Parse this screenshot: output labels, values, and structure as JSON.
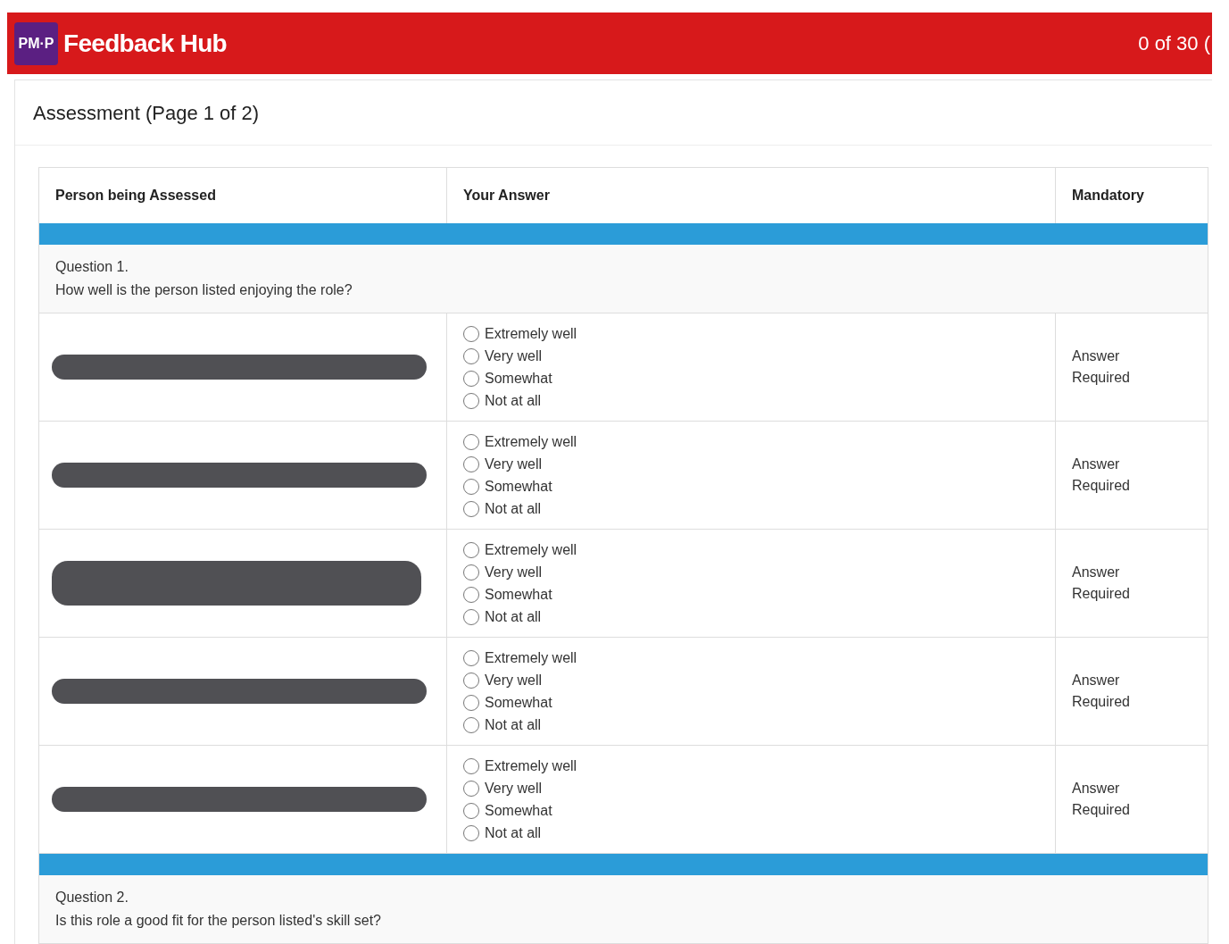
{
  "header": {
    "logo": "PM·P",
    "title": "Feedback Hub",
    "progress": "0 of 30 ("
  },
  "page_title": "Assessment (Page 1 of 2)",
  "table": {
    "columns": [
      "Person being Assessed",
      "Your Answer",
      "Mandatory"
    ],
    "questions": [
      {
        "number": "Question 1.",
        "text": "How well is the person listed enjoying the role?",
        "rows": [
          {
            "person": {
              "kind": "redacted"
            },
            "options": [
              {
                "label": "Extremely well",
                "selected": false
              },
              {
                "label": "Very well",
                "selected": false
              },
              {
                "label": "Somewhat",
                "selected": false
              },
              {
                "label": "Not at all",
                "selected": false
              }
            ],
            "mandatory": "Answer Required"
          },
          {
            "person": {
              "kind": "redacted"
            },
            "options": [
              {
                "label": "Extremely well",
                "selected": false
              },
              {
                "label": "Very well",
                "selected": false
              },
              {
                "label": "Somewhat",
                "selected": false
              },
              {
                "label": "Not at all",
                "selected": false
              }
            ],
            "mandatory": "Answer Required"
          },
          {
            "person": {
              "kind": "redacted_wrapped"
            },
            "options": [
              {
                "label": "Extremely well",
                "selected": false
              },
              {
                "label": "Very well",
                "selected": false
              },
              {
                "label": "Somewhat",
                "selected": false
              },
              {
                "label": "Not at all",
                "selected": false
              }
            ],
            "mandatory": "Answer Required"
          },
          {
            "person": {
              "kind": "redacted"
            },
            "options": [
              {
                "label": "Extremely well",
                "selected": false
              },
              {
                "label": "Very well",
                "selected": false
              },
              {
                "label": "Somewhat",
                "selected": false
              },
              {
                "label": "Not at all",
                "selected": false
              }
            ],
            "mandatory": "Answer Required"
          },
          {
            "person": {
              "kind": "redacted"
            },
            "options": [
              {
                "label": "Extremely well",
                "selected": false
              },
              {
                "label": "Very well",
                "selected": false
              },
              {
                "label": "Somewhat",
                "selected": false
              },
              {
                "label": "Not at all",
                "selected": false
              }
            ],
            "mandatory": "Answer Required"
          }
        ]
      },
      {
        "number": "Question 2.",
        "text": "Is this role a good fit for the person listed's skill set?"
      }
    ]
  }
}
